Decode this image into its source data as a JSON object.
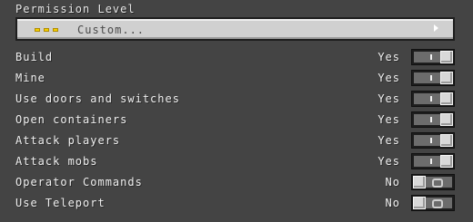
{
  "section": {
    "title": "Permission Level"
  },
  "dropdown": {
    "selected": "Custom...",
    "icon": "dots-icon"
  },
  "permissions": [
    {
      "label": "Build",
      "value": "Yes",
      "enabled": true
    },
    {
      "label": "Mine",
      "value": "Yes",
      "enabled": true
    },
    {
      "label": "Use doors and switches",
      "value": "Yes",
      "enabled": true
    },
    {
      "label": "Open containers",
      "value": "Yes",
      "enabled": true
    },
    {
      "label": "Attack players",
      "value": "Yes",
      "enabled": true
    },
    {
      "label": "Attack mobs",
      "value": "Yes",
      "enabled": true
    },
    {
      "label": "Operator Commands",
      "value": "No",
      "enabled": false
    },
    {
      "label": "Use Teleport",
      "value": "No",
      "enabled": false
    }
  ]
}
